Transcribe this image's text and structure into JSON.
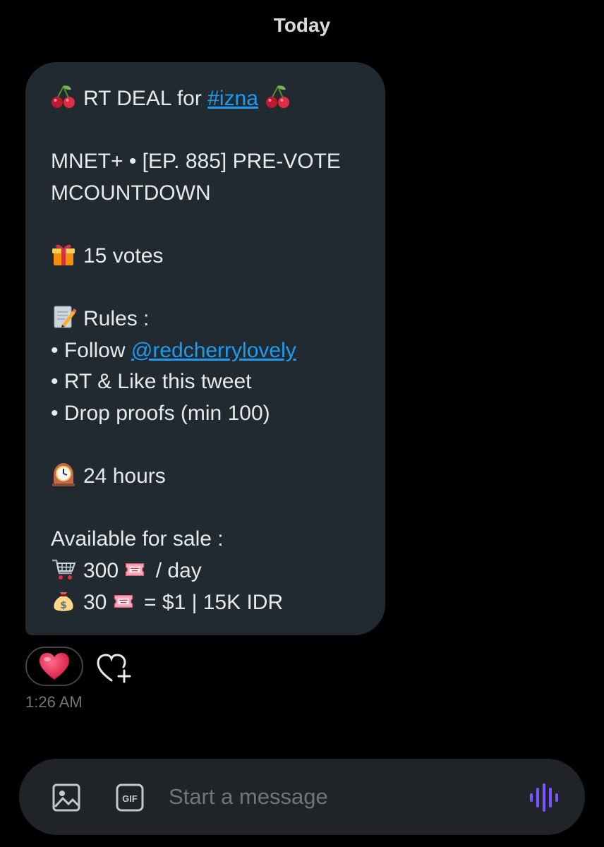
{
  "conversation": {
    "date_separator": "Today",
    "message": {
      "line1_prefix": "RT DEAL for ",
      "hashtag": "#izna",
      "line2": "MNET+ • [EP. 885] PRE-VOTE",
      "line3": "MCOUNTDOWN",
      "votes": "15 votes",
      "rules_title": "Rules :",
      "rule1_prefix": "• Follow ",
      "mention": "@redcherrylovely",
      "rule2": "• RT & Like this tweet",
      "rule3": "• Drop proofs (min 100)",
      "duration": "24 hours",
      "sale_title": "Available for sale :",
      "sale1_amount": "300",
      "sale1_suffix": " / day",
      "sale2_amount": "30",
      "sale2_suffix": " = $1 | 15K IDR"
    },
    "reactions": {
      "emoji": "heart-emoji"
    },
    "timestamp": "1:26 AM"
  },
  "composer": {
    "placeholder": "Start a message",
    "gif_label": "GIF"
  },
  "icons": {
    "cherry": "cherry-emoji",
    "gift": "gift-emoji",
    "memo": "memo-emoji",
    "clock": "mantelpiece-clock-emoji",
    "cart": "shopping-cart-emoji",
    "ticket": "admission-ticket-emoji",
    "moneybag": "money-bag-emoji",
    "image": "image-icon",
    "gif": "gif-icon",
    "voice": "voice-waveform-icon",
    "add_reaction": "add-reaction-icon"
  },
  "colors": {
    "background": "#000000",
    "bubble": "#222a31",
    "link": "#1d9bf0",
    "text": "#e7e9ea",
    "muted": "#71767b",
    "composer": "#202327",
    "voice": "#7856ff",
    "heart": "#f91880"
  }
}
